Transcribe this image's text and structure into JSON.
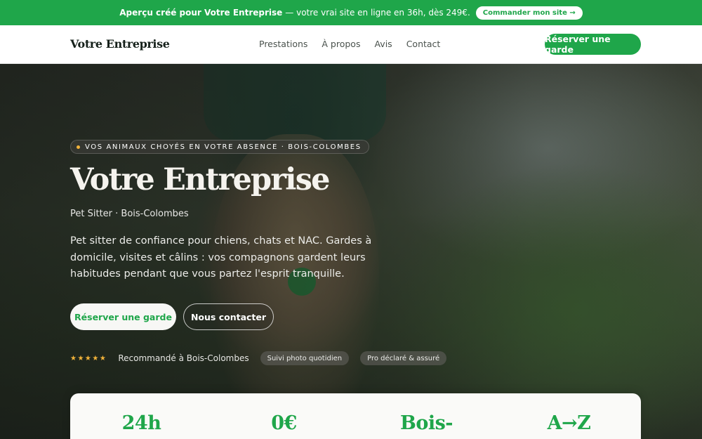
{
  "promo": {
    "strong_text": "Aperçu créé pour Votre Entreprise",
    "rest_text": "— votre vrai site en ligne en 36h, dès 249€.",
    "cta_label": "Commander mon site →"
  },
  "nav": {
    "brand": "Votre Entreprise",
    "links": [
      "Prestations",
      "À propos",
      "Avis",
      "Contact"
    ],
    "cta_label": "Réserver une garde"
  },
  "hero": {
    "eyebrow": "VOS ANIMAUX CHOYÉS EN VOTRE ABSENCE · BOIS-COLOMBES",
    "title": "Votre Entreprise",
    "subtitle": "Pet Sitter · Bois-Colombes",
    "description": "Pet sitter de confiance pour chiens, chats et NAC. Gardes à domicile, visites et câlins : vos compagnons gardent leurs habitudes pendant que vous partez l'esprit tranquille.",
    "primary_button": "Réserver une garde",
    "secondary_button": "Nous contacter",
    "stars": "★★★★★",
    "rating_text": "Recommandé à Bois-Colombes",
    "chips": [
      "Suivi photo quotidien",
      "Pro déclaré & assuré"
    ]
  },
  "stats": [
    "24h",
    "0€",
    "Bois-",
    "A→Z"
  ],
  "colors": {
    "brand_green": "#1fa64a",
    "star_gold": "#f2b33a"
  }
}
